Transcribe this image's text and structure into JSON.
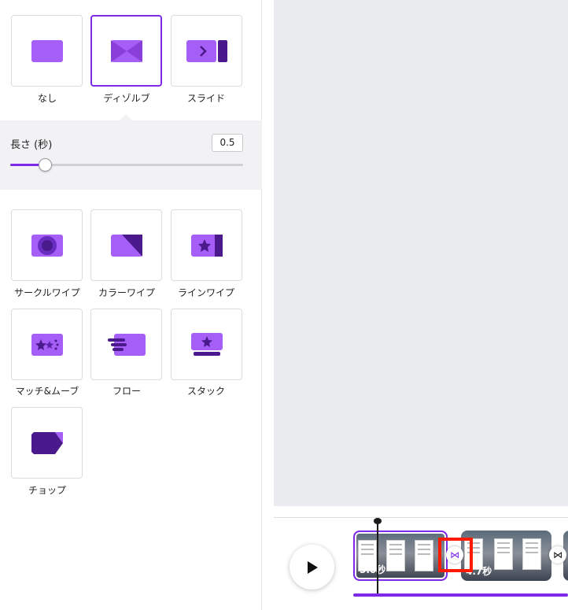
{
  "transitions_top": [
    {
      "id": "none",
      "label": "なし",
      "selected": false
    },
    {
      "id": "dissolve",
      "label": "ディゾルブ",
      "selected": true
    },
    {
      "id": "slide",
      "label": "スライド",
      "selected": false
    }
  ],
  "duration": {
    "label": "長さ (秒)",
    "value": "0.5",
    "slider_fraction": 0.15
  },
  "transitions_more": [
    {
      "id": "circle-wipe",
      "label": "サークルワイプ"
    },
    {
      "id": "color-wipe",
      "label": "カラーワイプ"
    },
    {
      "id": "line-wipe",
      "label": "ラインワイプ"
    },
    {
      "id": "match-move",
      "label": "マッチ&ムーブ"
    },
    {
      "id": "flow",
      "label": "フロー"
    },
    {
      "id": "stack",
      "label": "スタック"
    },
    {
      "id": "chop",
      "label": "チョップ"
    }
  ],
  "timeline": {
    "clips": [
      {
        "duration": "5.0秒",
        "selected": true
      },
      {
        "duration": "4.7秒",
        "selected": false
      }
    ],
    "transition_icon": "⋈"
  },
  "colors": {
    "accent": "#7d2ae8",
    "icon_light": "#a55ef6",
    "icon_dark": "#4a1a8c",
    "highlight": "#ff1a00"
  }
}
